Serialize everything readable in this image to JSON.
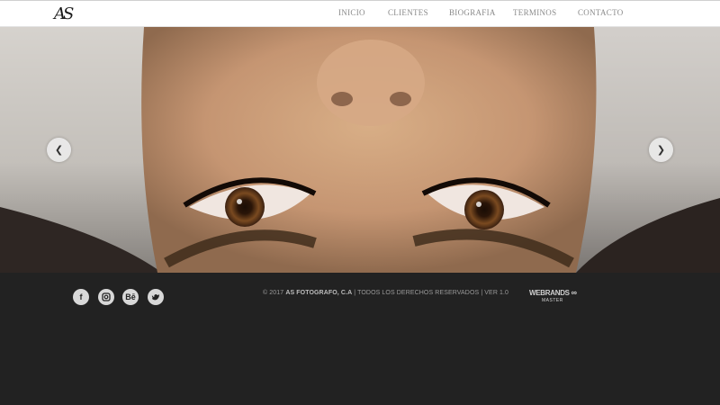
{
  "header": {
    "logo_text": "AS",
    "nav": [
      "INICIO",
      "CLIENTES",
      "BIOGRAFIA",
      "TERMINOS",
      "CONTACTO"
    ]
  },
  "slider": {
    "prev_icon": "chevron-left-icon",
    "next_icon": "chevron-right-icon"
  },
  "footer": {
    "social": [
      "facebook-icon",
      "instagram-icon",
      "behance-icon",
      "twitter-icon"
    ],
    "copyright_prefix": "© 2017 ",
    "copyright_brand": "AS FOTOGRAFO, C.A",
    "copyright_suffix": " | TODOS LOS DERECHOS RESERVADOS | VER 1.0",
    "credit_brand": "WEBRANDS",
    "credit_sub": "MASTER"
  },
  "colors": {
    "footer_bg": "#222222",
    "header_bg": "#ffffff",
    "nav_text": "#8a8a8a"
  }
}
